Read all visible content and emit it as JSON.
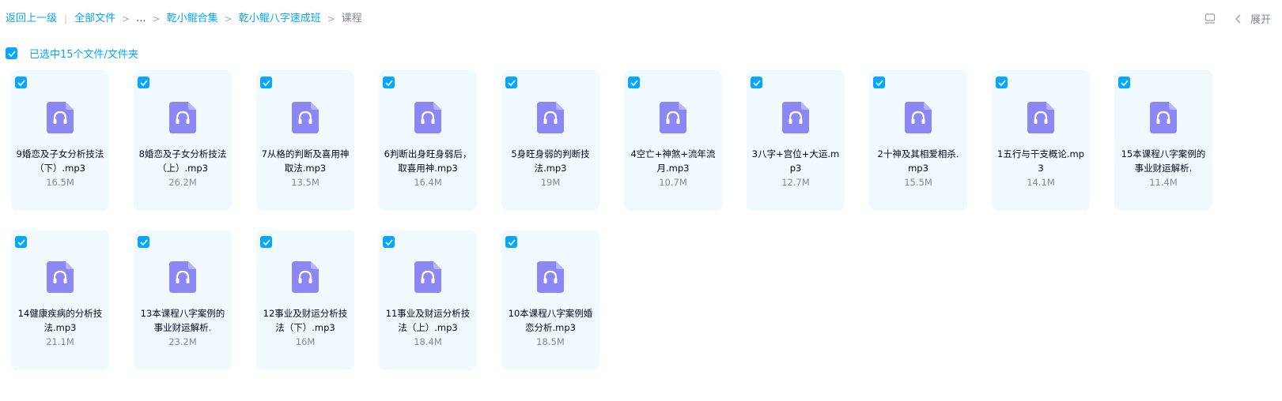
{
  "breadcrumb": {
    "back": "返回上一级",
    "root": "全部文件",
    "ellipsis": "...",
    "folder1": "乾小鲲合集",
    "folder2": "乾小鲲八字速成班",
    "current": "课程"
  },
  "toolbar": {
    "expand_label": "展开"
  },
  "selection": {
    "label": "已选中15个文件/文件夹"
  },
  "colors": {
    "accent": "#06a7ff",
    "card_bg": "#f0f9fe",
    "icon_purple": "#8b87f5"
  },
  "files": [
    {
      "name": "9婚恋及子女分析技法（下）.mp3",
      "size": "16.5M"
    },
    {
      "name": "8婚恋及子女分析技法（上）.mp3",
      "size": "26.2M"
    },
    {
      "name": "7从格的判断及喜用神取法.mp3",
      "size": "13.5M"
    },
    {
      "name": "6判断出身旺身弱后，取喜用神.mp3",
      "size": "16.4M"
    },
    {
      "name": "5身旺身弱的判断技法.mp3",
      "size": "19M"
    },
    {
      "name": "4空亡+神煞+流年流月.mp3",
      "size": "10.7M"
    },
    {
      "name": "3八字+宫位+大运.mp3",
      "size": "12.7M"
    },
    {
      "name": "2十神及其相爱相杀.mp3",
      "size": "15.5M"
    },
    {
      "name": "1五行与干支概论.mp3",
      "size": "14.1M"
    },
    {
      "name": "15本课程八字案例的事业财运解析.",
      "size": "11.4M"
    },
    {
      "name": "14健康疾病的分析技法.mp3",
      "size": "21.1M"
    },
    {
      "name": "13本课程八字案例的事业财运解析.",
      "size": "23.2M"
    },
    {
      "name": "12事业及财运分析技法（下）.mp3",
      "size": "16M"
    },
    {
      "name": "11事业及财运分析技法（上）.mp3",
      "size": "18.4M"
    },
    {
      "name": "10本课程八字案例婚恋分析.mp3",
      "size": "18.5M"
    }
  ]
}
